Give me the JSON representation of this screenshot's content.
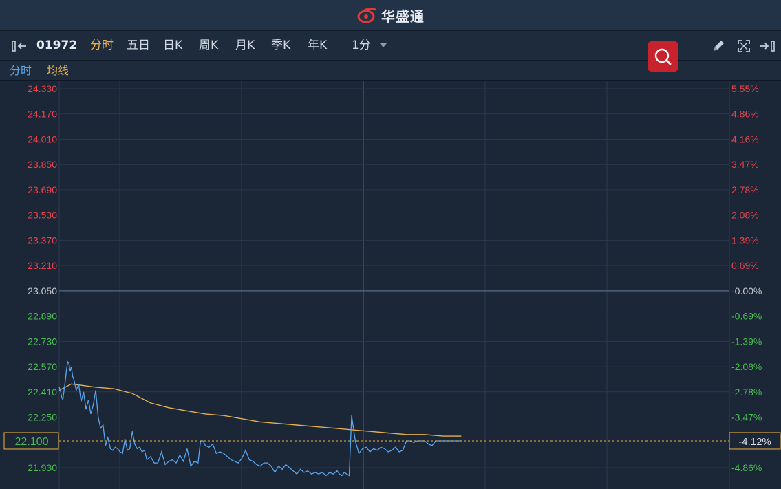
{
  "brand": {
    "name": "华盛通"
  },
  "toolbar": {
    "stock_code": "01972",
    "tabs": [
      "分时",
      "五日",
      "日K",
      "周K",
      "月K",
      "季K",
      "年K"
    ],
    "active_tab": "分时",
    "interval": "1分"
  },
  "legend": {
    "line": "分时",
    "avg": "均线"
  },
  "colors": {
    "up": "#e8444a",
    "down": "#4cbd52",
    "neutral": "#c5cbd3",
    "price_line": "#5aa6ee",
    "avg_line": "#e2b052",
    "accent": "#f0b443",
    "search_bg": "#c8232c"
  },
  "current": {
    "price": "22.100",
    "change_pct": "-4.12%"
  },
  "chart_data": {
    "type": "line",
    "y_ticks": [
      "24.330",
      "24.170",
      "24.010",
      "23.850",
      "23.690",
      "23.530",
      "23.370",
      "23.210",
      "23.050",
      "22.890",
      "22.730",
      "22.570",
      "22.410",
      "22.250",
      "21.930"
    ],
    "pct_ticks": [
      "5.55%",
      "4.86%",
      "4.16%",
      "3.47%",
      "2.78%",
      "2.08%",
      "1.39%",
      "0.69%",
      "-0.00%",
      "-0.69%",
      "-1.39%",
      "-2.08%",
      "-2.78%",
      "-3.47%",
      "-4.86%"
    ],
    "prev_close": 23.05,
    "ylim": [
      21.93,
      24.33
    ],
    "x_minutes_total": 330,
    "series": [
      {
        "x": [
          0,
          1,
          2,
          3,
          4,
          5,
          6,
          7,
          8,
          9,
          10,
          11,
          12,
          14,
          16,
          18,
          20,
          22,
          24,
          26,
          28,
          30,
          32,
          34,
          36,
          38,
          40,
          42,
          44,
          46,
          48,
          50,
          52,
          54,
          56,
          58,
          60,
          62,
          64,
          66,
          68,
          70,
          72,
          75,
          78,
          81,
          84,
          87,
          90,
          93,
          96,
          99,
          102,
          105,
          108,
          111,
          114,
          116,
          118,
          120,
          123,
          126,
          129,
          132,
          135,
          138,
          141,
          144,
          147,
          150,
          153,
          156,
          159,
          162,
          165,
          168,
          171,
          174,
          177,
          180,
          183,
          186,
          189,
          192,
          195,
          198,
          201,
          204,
          207,
          210,
          213,
          216,
          219,
          222,
          225,
          228,
          230,
          232,
          234,
          236,
          238,
          240,
          243,
          246,
          249,
          252,
          255,
          258,
          261,
          264,
          267,
          270,
          273,
          276,
          279,
          282,
          285,
          288,
          291,
          294,
          297,
          300,
          303,
          306,
          309,
          312,
          315,
          318,
          321,
          324,
          327,
          330
        ],
        "values": [
          22.44,
          22.42,
          22.38,
          22.36,
          22.42,
          22.48,
          22.55,
          22.6,
          22.59,
          22.54,
          22.57,
          22.51,
          22.49,
          22.42,
          22.46,
          22.35,
          22.41,
          22.3,
          22.36,
          22.27,
          22.33,
          22.42,
          22.25,
          22.18,
          22.2,
          22.07,
          22.12,
          22.05,
          22.04,
          22.06,
          22.05,
          22.03,
          22.02,
          22.11,
          22.04,
          22.05,
          22.16,
          22.08,
          22.05,
          22.06,
          22.03,
          22.04,
          21.98,
          22.0,
          21.96,
          21.96,
          22.03,
          21.95,
          21.97,
          21.98,
          21.96,
          22.01,
          21.97,
          22.05,
          21.94,
          21.97,
          21.96,
          22.1,
          22.1,
          22.07,
          22.06,
          22.08,
          22.02,
          22.03,
          22.02,
          22.0,
          21.98,
          21.97,
          21.96,
          21.99,
          22.04,
          21.98,
          21.97,
          21.95,
          21.94,
          21.96,
          21.96,
          21.94,
          21.9,
          21.94,
          21.92,
          21.95,
          21.93,
          21.91,
          21.89,
          21.92,
          21.9,
          21.91,
          21.89,
          21.9,
          21.89,
          21.9,
          21.88,
          21.9,
          21.89,
          21.91,
          21.89,
          21.88,
          21.9,
          21.89,
          21.88,
          22.26,
          22.1,
          22.02,
          22.05,
          22.06,
          22.03,
          22.05,
          22.04,
          22.06,
          22.05,
          22.03,
          22.04,
          22.06,
          22.03,
          22.04,
          22.1,
          22.1,
          22.09,
          22.1,
          22.1,
          22.1,
          22.08,
          22.07,
          22.1,
          22.1,
          22.1,
          22.1,
          22.1,
          22.1,
          22.1,
          22.1
        ]
      },
      {
        "x": [
          0,
          5,
          10,
          20,
          30,
          45,
          60,
          75,
          90,
          105,
          120,
          135,
          150,
          165,
          180,
          195,
          210,
          225,
          240,
          255,
          270,
          285,
          300,
          315,
          330
        ],
        "values": [
          22.42,
          22.44,
          22.46,
          22.45,
          22.44,
          22.43,
          22.4,
          22.34,
          22.31,
          22.29,
          22.27,
          22.26,
          22.24,
          22.22,
          22.21,
          22.2,
          22.19,
          22.18,
          22.17,
          22.16,
          22.15,
          22.14,
          22.14,
          22.13,
          22.13
        ]
      }
    ]
  }
}
